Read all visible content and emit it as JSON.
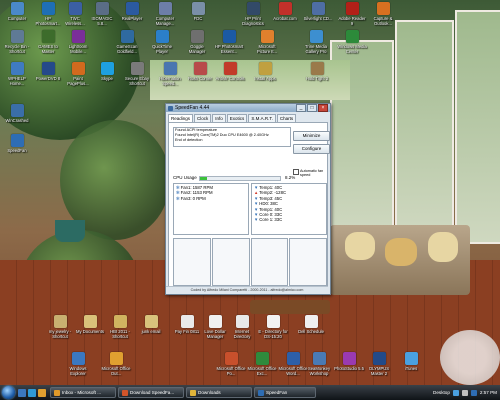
{
  "desktop": {
    "icons": [
      {
        "label": "Computer",
        "color": "#4a89c8"
      },
      {
        "label": "HP Photosmart...",
        "color": "#1e6fb5"
      },
      {
        "label": "TWC Wireless...",
        "color": "#3b5fa3"
      },
      {
        "label": "ISOMAGIC 5.8...",
        "color": "#5a6d86"
      },
      {
        "label": "RealPlayer",
        "color": "#2b5aa0"
      },
      {
        "label": "Computer Manage...",
        "color": "#6d7ea8"
      },
      {
        "label": "FDC",
        "color": "#7a8fa8"
      },
      {
        "label": "HP Print Diagnostics",
        "color": "#324a68"
      },
      {
        "label": "Acrobat.com",
        "color": "#c2302a"
      },
      {
        "label": "Silverlight CD...",
        "color": "#4e6ea4"
      },
      {
        "label": "Adobe Reader 9",
        "color": "#b22018"
      },
      {
        "label": "Capture & Outlook...",
        "color": "#d87020"
      },
      {
        "label": "Recycle Bin - Shortcut",
        "color": "#5f7a95"
      },
      {
        "label": "GAMES to Master",
        "color": "#3d6c2b"
      },
      {
        "label": "Lightroom Mobile...",
        "color": "#7a2f99"
      },
      {
        "label": "GameScan Goldfield...",
        "color": "#2f6aa0"
      },
      {
        "label": "QuickTime Player",
        "color": "#2b7fc9"
      },
      {
        "label": "Goggle Manager",
        "color": "#6f6f6f"
      },
      {
        "label": "HP Photosmart Essent...",
        "color": "#1b5aa5"
      },
      {
        "label": "Microsoft Picture It...",
        "color": "#e0802d"
      },
      {
        "label": "Trine Media Gallery Pro",
        "color": "#3d8fd0"
      },
      {
        "label": "Windows Media Center",
        "color": "#2c8a3a"
      },
      {
        "label": "WPHELP Home...",
        "color": "#3f7bc0"
      },
      {
        "label": "PowerDVD 8",
        "color": "#254a8a"
      },
      {
        "label": "Paint PagePlus...",
        "color": "#d26a1e"
      },
      {
        "label": "Skype",
        "color": "#1ea0e0"
      },
      {
        "label": "Secure Ebay Shortcut",
        "color": "#7a7a7a"
      },
      {
        "label": "Hibernation Speed...",
        "color": "#4a76b0"
      },
      {
        "label": "Rush Corner",
        "color": "#b84a4a"
      },
      {
        "label": "AntiVir Controls",
        "color": "#c23a2a"
      },
      {
        "label": "Install Apps",
        "color": "#c0a040"
      },
      {
        "label": "Hold Tight 2",
        "color": "#9a7a4a"
      },
      {
        "label": "WinCrashed",
        "color": "#3a6ea8"
      },
      {
        "label": "SpeedFan",
        "color": "#2e6db4"
      },
      {
        "label": "my jewelry - Shortcut",
        "color": "#c8b070"
      },
      {
        "label": "My Documents",
        "color": "#d9c27a"
      },
      {
        "label": "HBI 2011 - Shortcut",
        "color": "#d0b460"
      },
      {
        "label": "junk email",
        "color": "#d8c37c"
      },
      {
        "label": "Pay Fin 0811",
        "color": "#e9e9e9"
      },
      {
        "label": "Love Dollar Manager",
        "color": "#f0f0f0"
      },
      {
        "label": "Internet Directory",
        "color": "#e8e8e8"
      },
      {
        "label": "E - Directory for DS-15:20",
        "color": "#f2f2f2"
      },
      {
        "label": "Dell Schedule",
        "color": "#efefef"
      },
      {
        "label": "Windows Explorer",
        "color": "#3b78c0"
      },
      {
        "label": "Microsoft Office Out...",
        "color": "#e0a030"
      },
      {
        "label": "Microsoft Office Po...",
        "color": "#c8502c"
      },
      {
        "label": "Microsoft Office Exc...",
        "color": "#2f8a3c"
      },
      {
        "label": "Microsoft Office Word...",
        "color": "#2d5fa8"
      },
      {
        "label": "SeaMonkey Workshop",
        "color": "#4a7ab4"
      },
      {
        "label": "PhotoStudio 5.5",
        "color": "#9a3ab0"
      },
      {
        "label": "OLYMPUS Master 2",
        "color": "#234a88"
      },
      {
        "label": "iTunes",
        "color": "#4aa0e0"
      }
    ]
  },
  "speedfan": {
    "title": "SpeedFan 4.44",
    "tabs": [
      "Readings",
      "Clock",
      "Info",
      "Exotics",
      "S.M.A.R.T.",
      "Charts"
    ],
    "active_tab": "Readings",
    "log_lines": [
      "Found ACPI temperature",
      "Found Intel(R) Core(TM)2 Duo CPU E4600 @ 2.40GHz",
      "End of detection"
    ],
    "buttons": {
      "minimize": "Minimize",
      "configure": "Configure"
    },
    "auto_speed_label": "Automatic fan speed",
    "cpu_usage_label": "CPU Usage",
    "cpu_usage_value": "8.2%",
    "cpu_usage_fraction": 0.082,
    "fans": [
      {
        "label": "Fan1:",
        "value": "1587 RPM"
      },
      {
        "label": "Fan2:",
        "value": "1153 RPM"
      },
      {
        "label": "Fan3:",
        "value": "0 RPM"
      }
    ],
    "temps": [
      {
        "label": "Temp1:",
        "value": "40C",
        "direction": "down"
      },
      {
        "label": "Temp2:",
        "value": "-128C",
        "direction": "up"
      },
      {
        "label": "Temp3:",
        "value": "45C",
        "direction": "down"
      },
      {
        "label": "HD0:",
        "value": "38C",
        "direction": "down"
      },
      {
        "label": "Temp1:",
        "value": "40C",
        "direction": "down"
      },
      {
        "label": "Core 0:",
        "value": "33C",
        "direction": "down"
      },
      {
        "label": "Core 1:",
        "value": "33C",
        "direction": "down"
      }
    ],
    "footer": "Coded by Alfredo Milani Comparetti - 2000-2011 - alfredo@almico.com"
  },
  "taskbar": {
    "tasks": [
      {
        "label": "Inbox - Microsoft ...",
        "color": "#e09a2a"
      },
      {
        "label": "Download SpeedFa...",
        "color": "#d2552a"
      },
      {
        "label": "Downloads",
        "color": "#e0b43a"
      },
      {
        "label": "SpeedFan",
        "color": "#2e6db4"
      }
    ],
    "tray_label": "Desktop",
    "clock": "2:57 PM"
  }
}
